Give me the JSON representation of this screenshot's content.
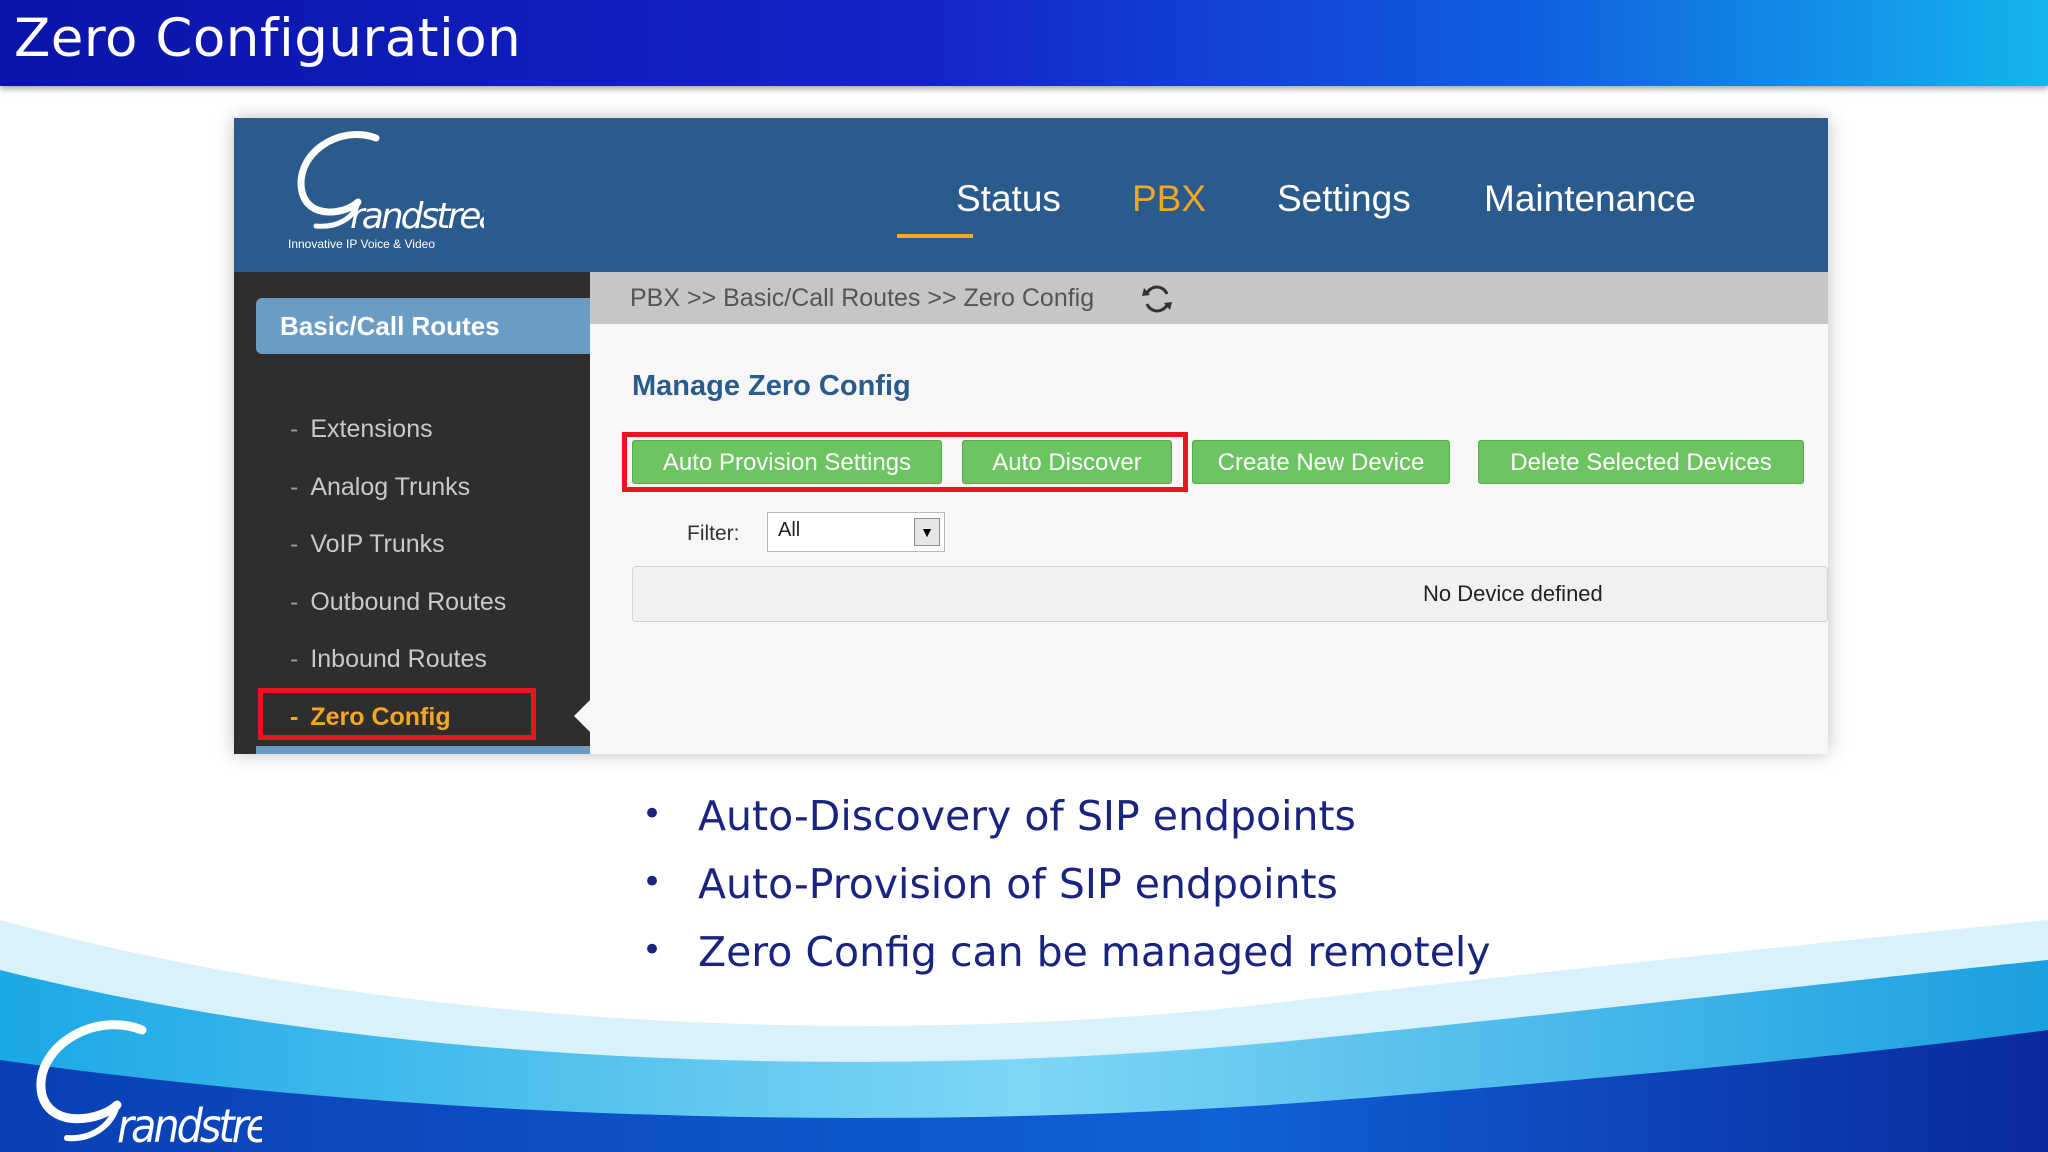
{
  "slide": {
    "title": "Zero Configuration",
    "bullets": [
      "Auto-Discovery of SIP endpoints",
      "Auto-Provision of SIP endpoints",
      "Zero Config can be managed remotely"
    ]
  },
  "logo": {
    "brand": "Grandstream",
    "tagline": "Innovative IP Voice & Video"
  },
  "nav": {
    "items": [
      "Status",
      "PBX",
      "Settings",
      "Maintenance"
    ],
    "active": "PBX"
  },
  "breadcrumb": "PBX >> Basic/Call Routes >> Zero Config",
  "sidebar": {
    "section": "Basic/Call Routes",
    "items": [
      "Extensions",
      "Analog Trunks",
      "VoIP Trunks",
      "Outbound Routes",
      "Inbound Routes",
      "Zero Config"
    ],
    "dash": "-",
    "active": "Zero Config"
  },
  "main": {
    "title": "Manage Zero Config",
    "buttons": {
      "auto_provision": "Auto Provision Settings",
      "auto_discover": "Auto Discover",
      "create_device": "Create New Device",
      "delete_devices": "Delete Selected Devices"
    },
    "filter": {
      "label": "Filter:",
      "value": "All"
    },
    "empty_message": "No Device defined"
  },
  "colors": {
    "header_blue": "#2a5b8c",
    "accent_orange": "#f5a623",
    "button_green": "#6cc560",
    "highlight_red": "#e8141e",
    "bullet_text": "#1a2480"
  }
}
